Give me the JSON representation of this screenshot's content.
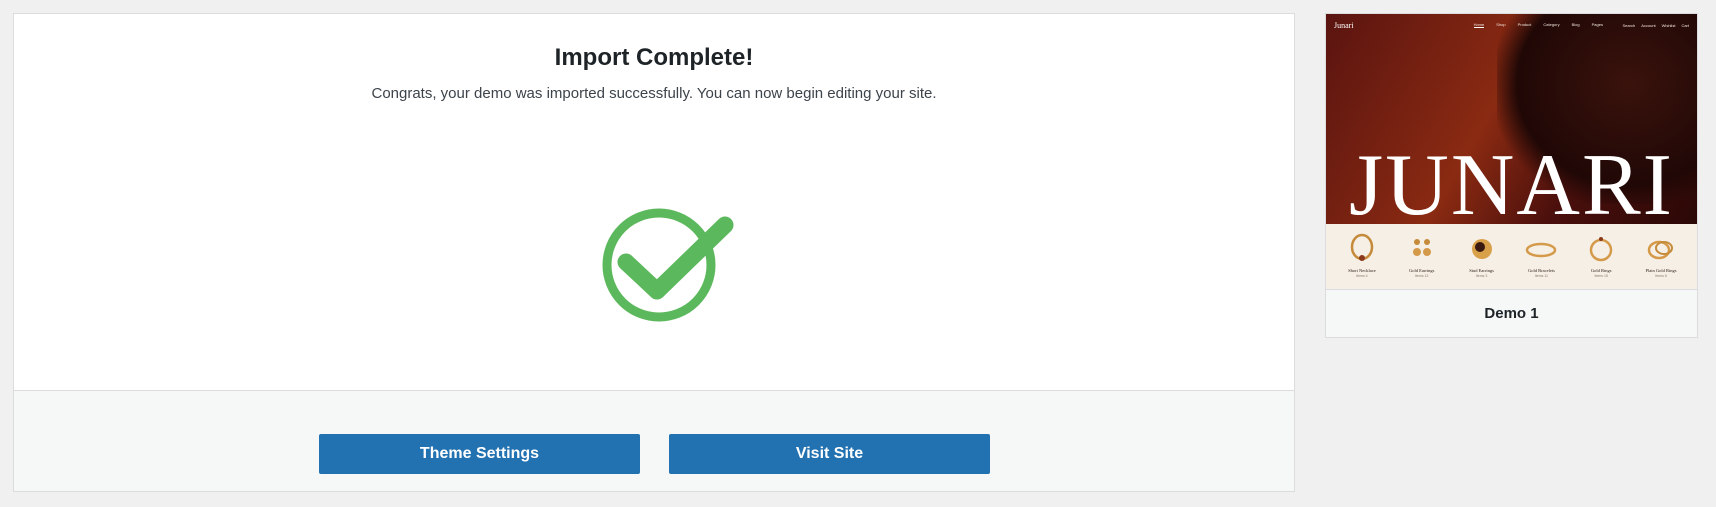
{
  "import_panel": {
    "title": "Import Complete!",
    "subtitle": "Congrats, your demo was imported successfully. You can now begin editing your site.",
    "status_icon": "check-circle-icon",
    "check_color": "#5cb85c",
    "buttons": {
      "theme_settings": "Theme Settings",
      "visit_site": "Visit Site"
    },
    "button_color": "#2271b1"
  },
  "demo_card": {
    "label": "Demo 1",
    "preview": {
      "logo": "Junari",
      "brand": "JUNARI",
      "menu": [
        "Home",
        "Shop",
        "Product",
        "Category",
        "Blog",
        "Pages"
      ],
      "utilities": [
        "Search",
        "Account",
        "Wishlist",
        "Cart"
      ],
      "products": [
        {
          "name": "Short Necklace",
          "sub": "Items 4"
        },
        {
          "name": "Gold Earrings",
          "sub": "Items 12"
        },
        {
          "name": "Stud Earrings",
          "sub": "Items 3"
        },
        {
          "name": "Gold Bracelets",
          "sub": "Items 11"
        },
        {
          "name": "Gold Rings",
          "sub": "Items 15"
        },
        {
          "name": "Plain Gold Rings",
          "sub": "Items 6"
        }
      ]
    }
  }
}
